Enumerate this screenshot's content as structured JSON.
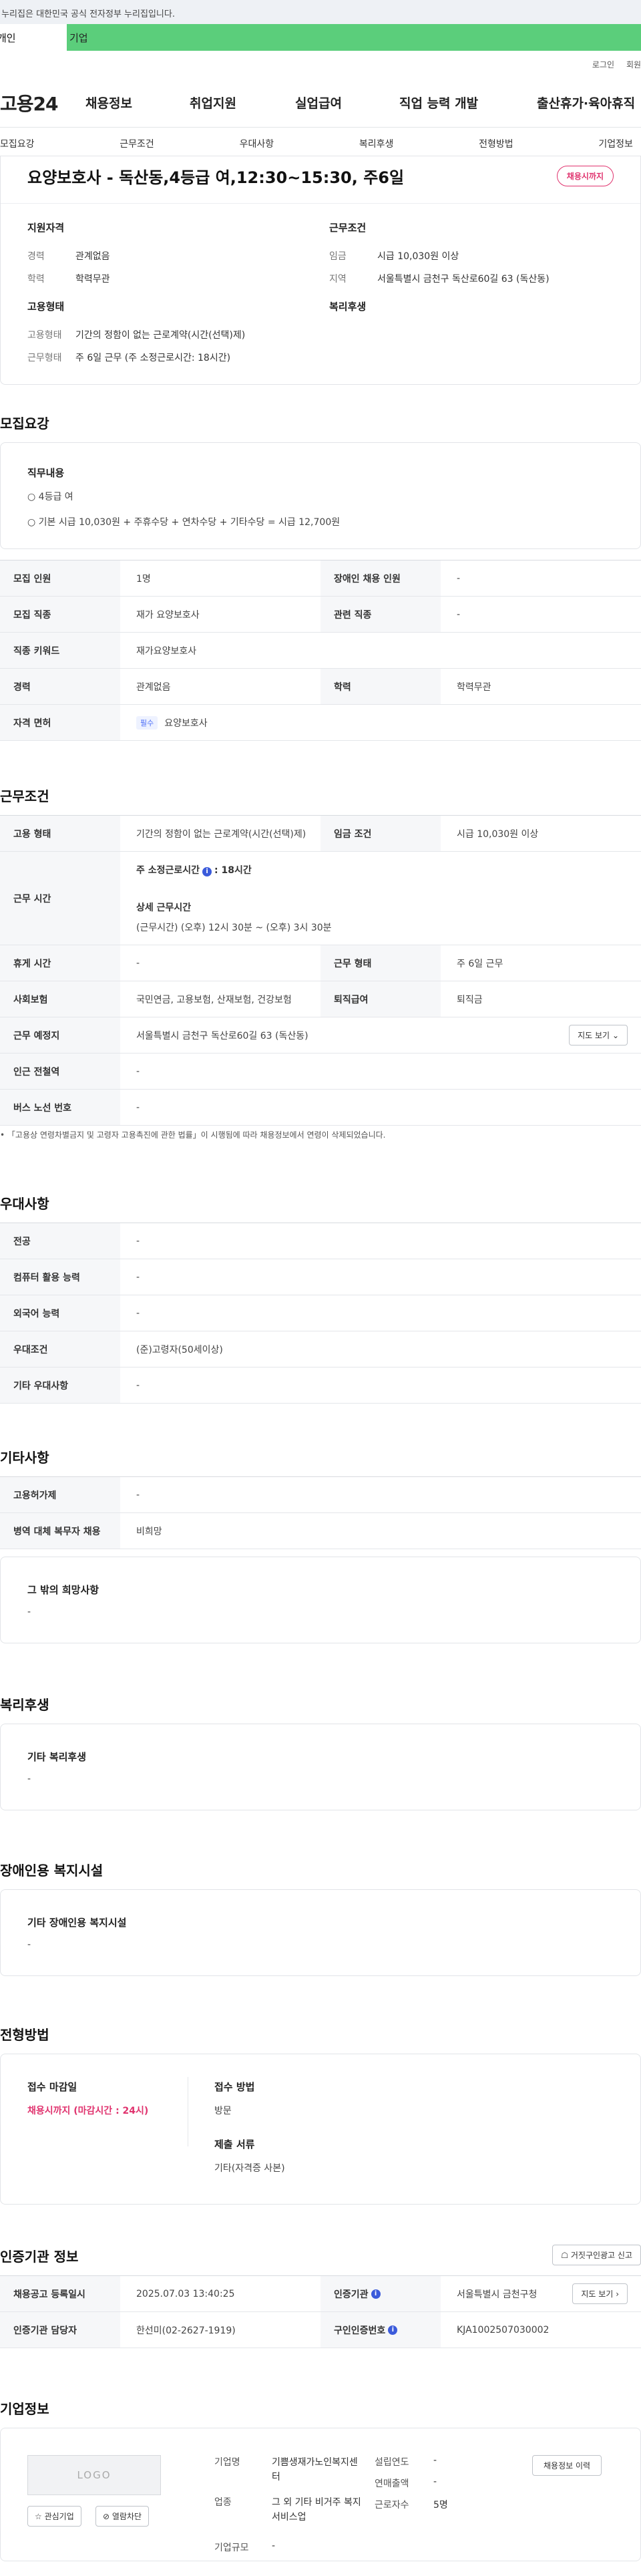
{
  "gov_banner": "이 누리집은 대한민국 공식 전자정부 누리집입니다.",
  "user_tabs": [
    "개인",
    "기업"
  ],
  "top_links": [
    "로그인",
    "회원가입"
  ],
  "logo": "고용24",
  "main_nav": [
    "채용정보",
    "취업지원",
    "실업급여",
    "직업 능력 개발",
    "출산휴가·육아휴직"
  ],
  "sub_nav": [
    "모집요강",
    "근무조건",
    "우대사항",
    "복리후생",
    "전형방법",
    "기업정보"
  ],
  "job_title": "요양보호사 - 독산동,4등급 여,12:30~15:30, 주6일",
  "deadline_badge": "채용시까지",
  "summary": {
    "qual_h": "지원자격",
    "qual": [
      {
        "k": "경력",
        "v": "관계없음"
      },
      {
        "k": "학력",
        "v": "학력무관"
      }
    ],
    "emp_h": "고용형태",
    "emp": [
      {
        "k": "고용형태",
        "v": "기간의 정함이 없는 근로계약(시간(선택)제)"
      },
      {
        "k": "근무형태",
        "v": "주 6일 근무 (주 소정근로시간: 18시간)"
      }
    ],
    "cond_h": "근무조건",
    "cond": [
      {
        "k": "임금",
        "v": "시급 10,030원 이상"
      },
      {
        "k": "지역",
        "v": "서울특별시 금천구 독산로60길 63 (독산동)"
      }
    ],
    "welfare_h": "복리후생"
  },
  "recruit": {
    "title": "모집요강",
    "duty_h": "직무내용",
    "duty_lines": [
      "○ 4등급 여",
      "○ 기본 시급 10,030원 + 주휴수당 + 연차수당 + 기타수당 = 시급 12,700원"
    ],
    "rows": [
      {
        "th1": "모집 인원",
        "td1": "1명",
        "th2": "장애인 채용 인원",
        "td2": "-"
      },
      {
        "th1": "모집 직종",
        "td1": "재가 요양보호사",
        "th2": "관련 직종",
        "td2": "-"
      },
      {
        "th1": "직종 키워드",
        "td1": "재가요양보호사"
      },
      {
        "th1": "경력",
        "td1": "관계없음",
        "th2": "학력",
        "td2": "학력무관"
      },
      {
        "th1": "자격 면허",
        "chip": "필수",
        "td1": "요양보호사"
      }
    ]
  },
  "work": {
    "title": "근무조건",
    "emp_type_h": "고용 형태",
    "emp_type": "기간의 정함이 없는 근로계약(시간(선택)제)",
    "wage_h": "임금 조건",
    "wage": "시급 10,030원 이상",
    "time_h": "근무 시간",
    "weekly_label": "주 소정근로시간",
    "weekly_value": ": 18시간",
    "detail_h": "상세 근무시간",
    "detail_v": "(근무시간) (오후) 12시 30분 ~ (오후) 3시 30분",
    "break_h": "휴게 시간",
    "break_v": "-",
    "form_h": "근무 형태",
    "form_v": "주 6일 근무",
    "ins_h": "사회보험",
    "ins_v": "국민연금, 고용보험, 산재보험, 건강보험",
    "ret_h": "퇴직급여",
    "ret_v": "퇴직금",
    "place_h": "근무 예정지",
    "place_v": "서울특별시 금천구 독산로60길 63 (독산동)",
    "map_btn": "지도 보기",
    "subway_h": "인근 전철역",
    "subway_v": "-",
    "bus_h": "버스 노선 번호",
    "bus_v": "-",
    "note": "「고용상 연령차별금지 및 고령자 고용촉진에 관한 법률」이 시행됨에 따라 채용정보에서 연령이 삭제되었습니다."
  },
  "pref": {
    "title": "우대사항",
    "rows": [
      {
        "th": "전공",
        "td": "-"
      },
      {
        "th": "컴퓨터 활용 능력",
        "td": "-"
      },
      {
        "th": "외국어 능력",
        "td": "-"
      },
      {
        "th": "우대조건",
        "td": "(준)고령자(50세이상)"
      },
      {
        "th": "기타 우대사항",
        "td": "-"
      }
    ]
  },
  "etc": {
    "title": "기타사항",
    "rows": [
      {
        "th": "고용허가제",
        "td": "-"
      },
      {
        "th": "병역 대체 복무자 채용",
        "td": "비희망"
      }
    ],
    "wish_h": "그 밖의 희망사항",
    "wish_v": "-"
  },
  "welfare": {
    "title": "복리후생",
    "h": "기타 복리후생",
    "v": "-"
  },
  "disability": {
    "title": "장애인용 복지시설",
    "h": "기타 장애인용 복지시설",
    "v": "-"
  },
  "selection": {
    "title": "전형방법",
    "deadline_h": "접수 마감일",
    "deadline_v": "채용시까지 (마감시간 : 24시)",
    "method_h": "접수 방법",
    "method_v": "방문",
    "docs_h": "제출 서류",
    "docs_v": "기타(자격증 사본)"
  },
  "cert": {
    "title": "인증기관 정보",
    "report_btn": "거짓구인광고 신고",
    "reg_h": "채용공고 등록일시",
    "reg_v": "2025.07.03 13:40:25",
    "org_h": "인증기관",
    "org_v": "서울특별시 금천구청",
    "map_btn": "지도 보기",
    "mgr_h": "인증기관 담당자",
    "mgr_v": "한선미(02-2627-1919)",
    "id_h": "구인인증번호",
    "id_v": "KJA1002507030002"
  },
  "company": {
    "title": "기업정보",
    "logo_text": "LOGO",
    "fav_btn": "관심기업",
    "block_btn": "열람차단",
    "name_h": "기업명",
    "name_v": "기쁨생재가노인복지센터",
    "biz_h": "업종",
    "biz_v": "그 외 기타 비거주 복지 서비스업",
    "size_h": "기업규모",
    "size_v": "-",
    "founded_h": "설립연도",
    "founded_v": "-",
    "sales_h": "연매출액",
    "sales_v": "-",
    "emp_h": "근로자수",
    "emp_v": "5명",
    "history_btn": "채용정보 이력"
  }
}
